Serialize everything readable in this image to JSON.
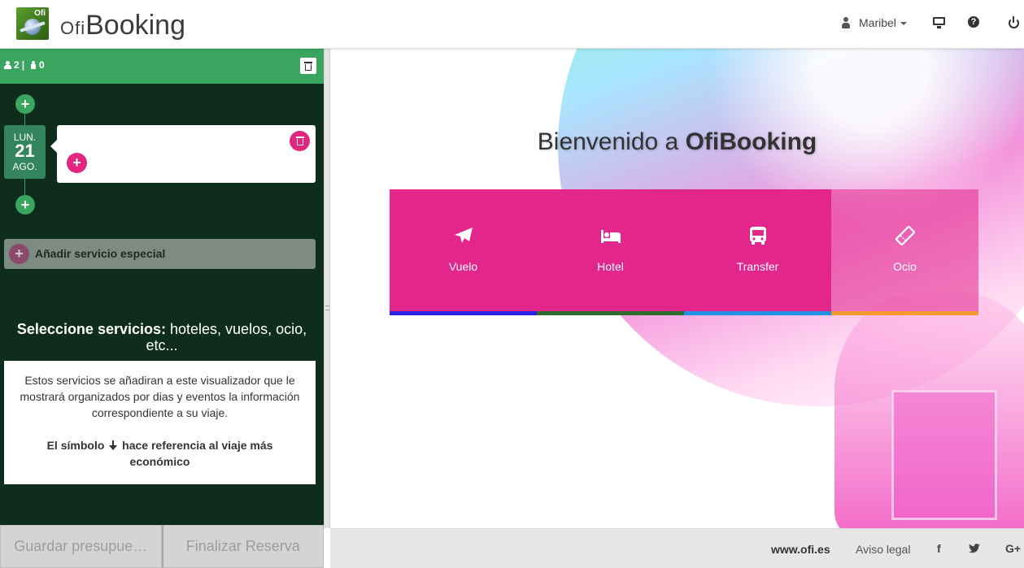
{
  "header": {
    "brand_prefix": "Ofi",
    "brand_name": "Booking",
    "logo_tag": "Ofi",
    "user_name": "Maribel",
    "help_glyph": "?"
  },
  "sidebar": {
    "adults_count": "2",
    "separator": "|",
    "children_count": "0",
    "date": {
      "dow": "LUN.",
      "day": "21",
      "month": "AGO."
    },
    "special_service_label": "Añadir servicio especial",
    "info_title_bold": "Seleccione servicios:",
    "info_title_rest": " hoteles, vuelos, ocio, etc...",
    "info_text": "Estos servicios se añadiran a este visualizador que le mostrará organizados por dias y eventos la información correspondiente a su viaje.",
    "info_symbol_prefix": "El símbolo",
    "info_symbol_suffix": "hace referencia al viaje más económico",
    "save_button": "Guardar presupue…",
    "finish_button": "Finalizar Reserva"
  },
  "main": {
    "welcome_prefix": "Bienvenido a ",
    "welcome_brand": "OfiBooking",
    "services": [
      {
        "label": "Vuelo",
        "icon": "plane-icon",
        "bar_color": "#2b22e6"
      },
      {
        "label": "Hotel",
        "icon": "bed-icon",
        "bar_color": "#2e6b2e"
      },
      {
        "label": "Transfer",
        "icon": "bus-icon",
        "bar_color": "#2391e6"
      },
      {
        "label": "Ocio",
        "icon": "ticket-icon",
        "bar_color": "#f29a2e"
      }
    ]
  },
  "footer": {
    "site": "www.ofi.es",
    "legal": "Aviso legal",
    "facebook": "f",
    "googleplus": "G+"
  },
  "colors": {
    "accent_green": "#3aa55e",
    "sidebar_bg": "#0f2d1c",
    "service_pink": "#e3268c"
  }
}
